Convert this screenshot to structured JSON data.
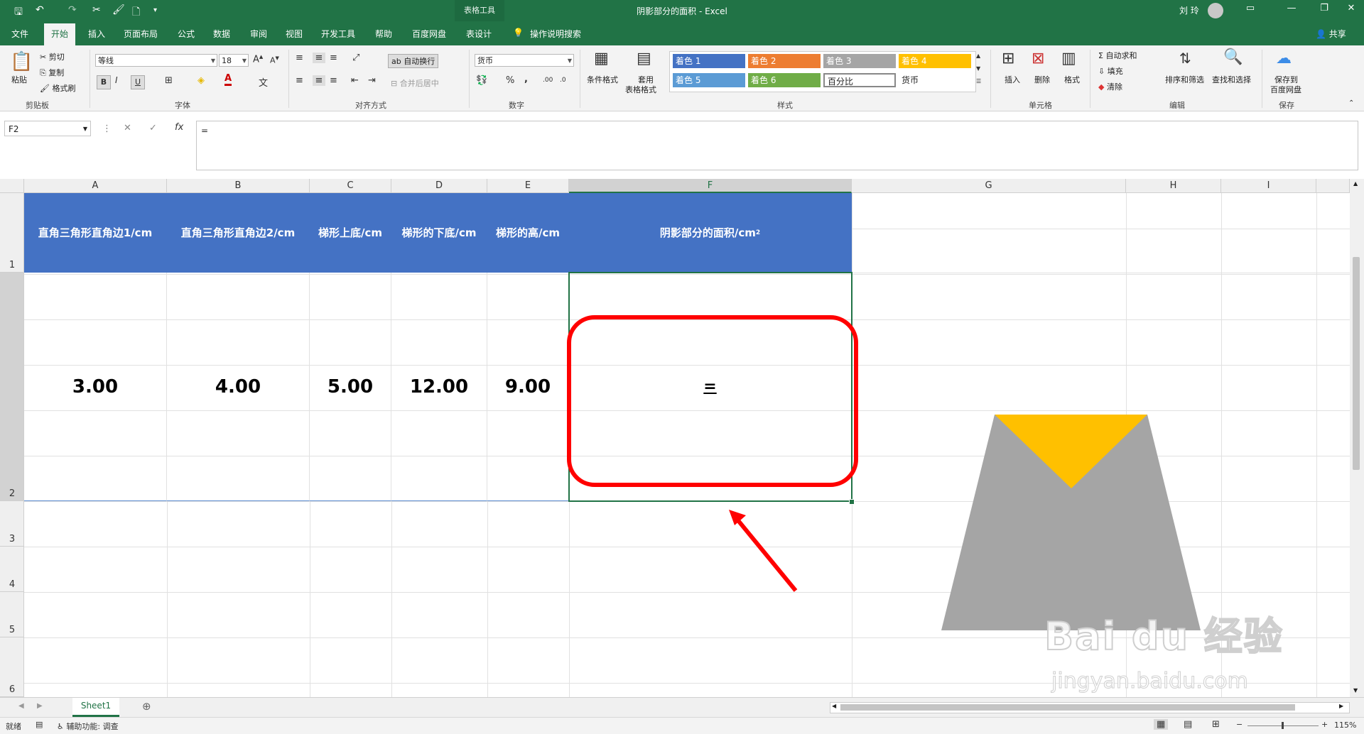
{
  "title_bar": {
    "document_title": "阴影部分的面积 - Excel",
    "context_tab_group": "表格工具",
    "user_name": "刘 玲",
    "share_label": "共享"
  },
  "menu": {
    "tabs": [
      "文件",
      "开始",
      "插入",
      "页面布局",
      "公式",
      "数据",
      "审阅",
      "视图",
      "开发工具",
      "帮助",
      "百度网盘",
      "表设计"
    ],
    "active_tab": "开始",
    "search_placeholder": "操作说明搜索"
  },
  "ribbon": {
    "clipboard": {
      "paste": "粘贴",
      "cut": "剪切",
      "copy": "复制",
      "format_painter": "格式刷",
      "label": "剪贴板"
    },
    "font": {
      "font_name": "等线",
      "font_size": "18",
      "label": "字体",
      "bold": "B",
      "italic": "I",
      "underline": "U"
    },
    "alignment": {
      "wrap_text": "自动换行",
      "merge_center": "合并后居中",
      "label": "对齐方式"
    },
    "number": {
      "format": "货币",
      "label": "数字",
      "percent": "%",
      "comma": ","
    },
    "styles": {
      "conditional": "条件格式",
      "table_format_1": "套用",
      "table_format_2": "表格格式",
      "label": "样式",
      "cells": [
        {
          "text": "着色 1",
          "color": "#4472c4"
        },
        {
          "text": "着色 2",
          "color": "#ed7d31"
        },
        {
          "text": "着色 3",
          "color": "#a5a5a5"
        },
        {
          "text": "着色 4",
          "color": "#ffc000"
        },
        {
          "text": "着色 5",
          "color": "#5b9bd5"
        },
        {
          "text": "着色 6",
          "color": "#70ad47"
        },
        {
          "text": "百分比",
          "color": "#ffffff"
        },
        {
          "text": "货币",
          "color": "#ffffff"
        }
      ]
    },
    "cells_group": {
      "insert": "插入",
      "delete": "删除",
      "format": "格式",
      "label": "单元格"
    },
    "editing": {
      "autosum": "自动求和",
      "fill": "填充",
      "clear": "清除",
      "sort_filter": "排序和筛选",
      "find_select": "查找和选择",
      "label": "编辑"
    },
    "save": {
      "save_to_1": "保存到",
      "save_to_2": "百度网盘",
      "label": "保存"
    }
  },
  "formula_bar": {
    "name_box": "F2",
    "formula": "="
  },
  "grid": {
    "columns": [
      "A",
      "B",
      "C",
      "D",
      "E",
      "F",
      "G",
      "H",
      "I"
    ],
    "selected_column": "F",
    "rows": [
      "1",
      "2",
      "3",
      "4",
      "5",
      "6"
    ],
    "headers": [
      "直角三角形直角边1/cm",
      "直角三角形直角边2/cm",
      "梯形上底/cm",
      "梯形的下底/cm",
      "梯形的高/cm",
      "阴影部分的面积/cm"
    ],
    "header_superscript": "2",
    "values": [
      "3.00",
      "4.00",
      "5.00",
      "12.00",
      "9.00",
      "="
    ]
  },
  "shapes": {
    "trapezoid_color": "#a5a5a5",
    "triangle_color": "#ffc000",
    "highlight_color": "#ff0000"
  },
  "watermark": {
    "brand": "Bai du 经验",
    "url": "jingyan.baidu.com"
  },
  "sheets": {
    "tabs": [
      "Sheet1"
    ],
    "active": "Sheet1"
  },
  "status": {
    "ready": "就绪",
    "accessibility": "辅助功能: 调查",
    "zoom": "115%"
  }
}
